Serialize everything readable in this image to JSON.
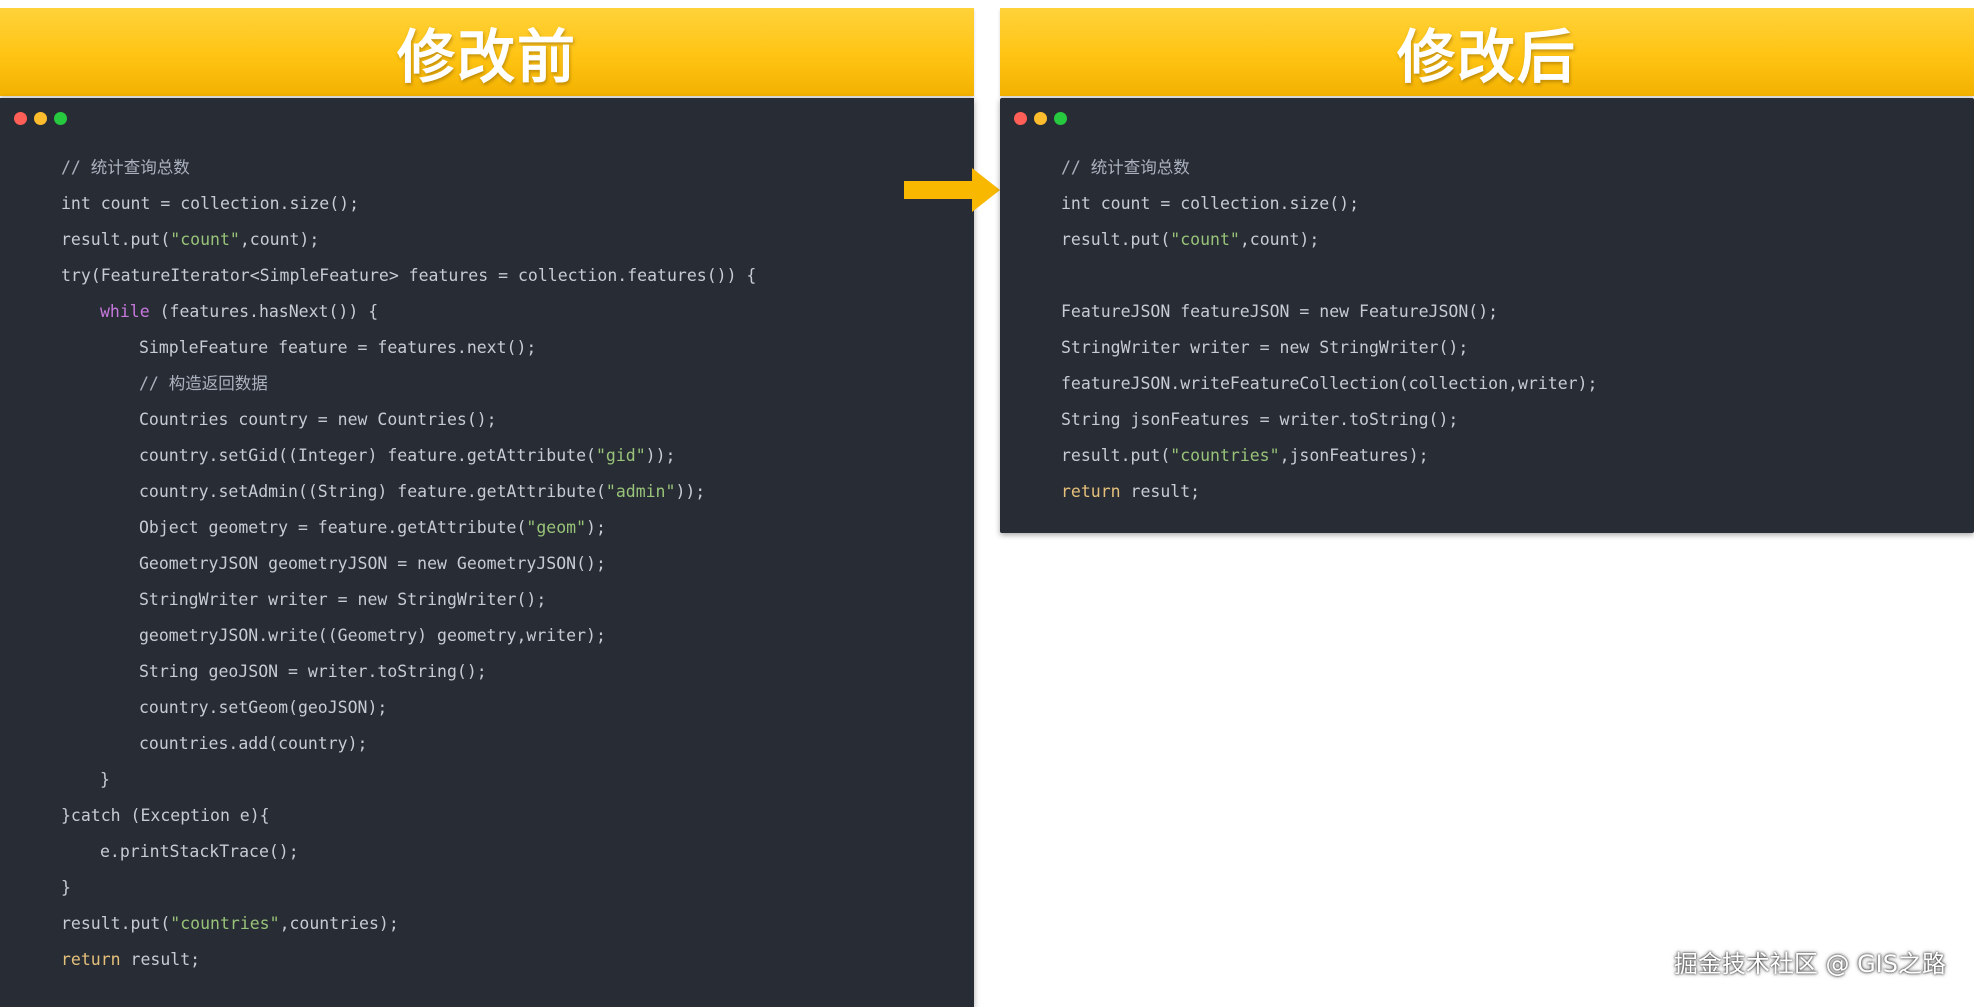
{
  "left_panel": {
    "title": "修改前",
    "lines": [
      {
        "indent": 0,
        "parts": [
          {
            "t": "// 统计查询总数",
            "c": "comment"
          }
        ]
      },
      {
        "indent": 0,
        "parts": [
          {
            "t": "int count = collection.size();",
            "c": ""
          }
        ]
      },
      {
        "indent": 0,
        "parts": [
          {
            "t": "result.put(",
            "c": ""
          },
          {
            "t": "\"count\"",
            "c": "str"
          },
          {
            "t": ",count);",
            "c": ""
          }
        ]
      },
      {
        "indent": 0,
        "parts": [
          {
            "t": "try(FeatureIterator<SimpleFeature> features = collection.features()) {",
            "c": ""
          }
        ]
      },
      {
        "indent": 1,
        "parts": [
          {
            "t": "while",
            "c": "kw"
          },
          {
            "t": " (features.hasNext()) {",
            "c": ""
          }
        ]
      },
      {
        "indent": 2,
        "parts": [
          {
            "t": "SimpleFeature feature = features.next();",
            "c": ""
          }
        ]
      },
      {
        "indent": 2,
        "parts": [
          {
            "t": "// 构造返回数据",
            "c": "comment"
          }
        ]
      },
      {
        "indent": 2,
        "parts": [
          {
            "t": "Countries country = new Countries();",
            "c": ""
          }
        ]
      },
      {
        "indent": 2,
        "parts": [
          {
            "t": "country.setGid((Integer) feature.getAttribute(",
            "c": ""
          },
          {
            "t": "\"gid\"",
            "c": "str"
          },
          {
            "t": "));",
            "c": ""
          }
        ]
      },
      {
        "indent": 2,
        "parts": [
          {
            "t": "country.setAdmin((String) feature.getAttribute(",
            "c": ""
          },
          {
            "t": "\"admin\"",
            "c": "str"
          },
          {
            "t": "));",
            "c": ""
          }
        ]
      },
      {
        "indent": 2,
        "parts": [
          {
            "t": "Object geometry = feature.getAttribute(",
            "c": ""
          },
          {
            "t": "\"geom\"",
            "c": "str"
          },
          {
            "t": ");",
            "c": ""
          }
        ]
      },
      {
        "indent": 2,
        "parts": [
          {
            "t": "GeometryJSON geometryJSON = new GeometryJSON();",
            "c": ""
          }
        ]
      },
      {
        "indent": 2,
        "parts": [
          {
            "t": "StringWriter writer = new StringWriter();",
            "c": ""
          }
        ]
      },
      {
        "indent": 2,
        "parts": [
          {
            "t": "geometryJSON.write((Geometry) geometry,writer);",
            "c": ""
          }
        ]
      },
      {
        "indent": 2,
        "parts": [
          {
            "t": "String geoJSON = writer.toString();",
            "c": ""
          }
        ]
      },
      {
        "indent": 2,
        "parts": [
          {
            "t": "country.setGeom(geoJSON);",
            "c": ""
          }
        ]
      },
      {
        "indent": 2,
        "parts": [
          {
            "t": "countries.add(country);",
            "c": ""
          }
        ]
      },
      {
        "indent": 1,
        "parts": [
          {
            "t": "}",
            "c": ""
          }
        ]
      },
      {
        "indent": 0,
        "parts": [
          {
            "t": "}catch (Exception e){",
            "c": ""
          }
        ]
      },
      {
        "indent": 1,
        "parts": [
          {
            "t": "e.printStackTrace();",
            "c": ""
          }
        ]
      },
      {
        "indent": 0,
        "parts": [
          {
            "t": "}",
            "c": ""
          }
        ]
      },
      {
        "indent": 0,
        "parts": [
          {
            "t": "result.put(",
            "c": ""
          },
          {
            "t": "\"countries\"",
            "c": "str"
          },
          {
            "t": ",countries);",
            "c": ""
          }
        ]
      },
      {
        "indent": 0,
        "parts": [
          {
            "t": "return",
            "c": "ret"
          },
          {
            "t": " result;",
            "c": ""
          }
        ]
      }
    ]
  },
  "right_panel": {
    "title": "修改后",
    "lines": [
      {
        "indent": 0,
        "parts": [
          {
            "t": "// 统计查询总数",
            "c": "comment"
          }
        ]
      },
      {
        "indent": 0,
        "parts": [
          {
            "t": "int count = collection.size();",
            "c": ""
          }
        ]
      },
      {
        "indent": 0,
        "parts": [
          {
            "t": "result.put(",
            "c": ""
          },
          {
            "t": "\"count\"",
            "c": "str"
          },
          {
            "t": ",count);",
            "c": ""
          }
        ]
      },
      {
        "indent": 0,
        "parts": [
          {
            "t": "",
            "c": ""
          }
        ]
      },
      {
        "indent": 0,
        "parts": [
          {
            "t": "FeatureJSON featureJSON = new FeatureJSON();",
            "c": ""
          }
        ]
      },
      {
        "indent": 0,
        "parts": [
          {
            "t": "StringWriter writer = new StringWriter();",
            "c": ""
          }
        ]
      },
      {
        "indent": 0,
        "parts": [
          {
            "t": "featureJSON.writeFeatureCollection(collection,writer);",
            "c": ""
          }
        ]
      },
      {
        "indent": 0,
        "parts": [
          {
            "t": "String jsonFeatures = writer.toString();",
            "c": ""
          }
        ]
      },
      {
        "indent": 0,
        "parts": [
          {
            "t": "result.put(",
            "c": ""
          },
          {
            "t": "\"countries\"",
            "c": "str"
          },
          {
            "t": ",jsonFeatures);",
            "c": ""
          }
        ]
      },
      {
        "indent": 0,
        "parts": [
          {
            "t": "return",
            "c": "ret"
          },
          {
            "t": " result;",
            "c": ""
          }
        ]
      }
    ]
  },
  "watermark": "掘金技术社区 @ GIS之路",
  "colors": {
    "banner": "#ffc413",
    "code_bg": "#282c34",
    "string": "#98c379",
    "keyword": "#c678dd",
    "return_keyword": "#e5c07b",
    "arrow": "#f8b800"
  },
  "icons": [
    "window-close-dot",
    "window-minimize-dot",
    "window-maximize-dot",
    "right-arrow-icon"
  ]
}
